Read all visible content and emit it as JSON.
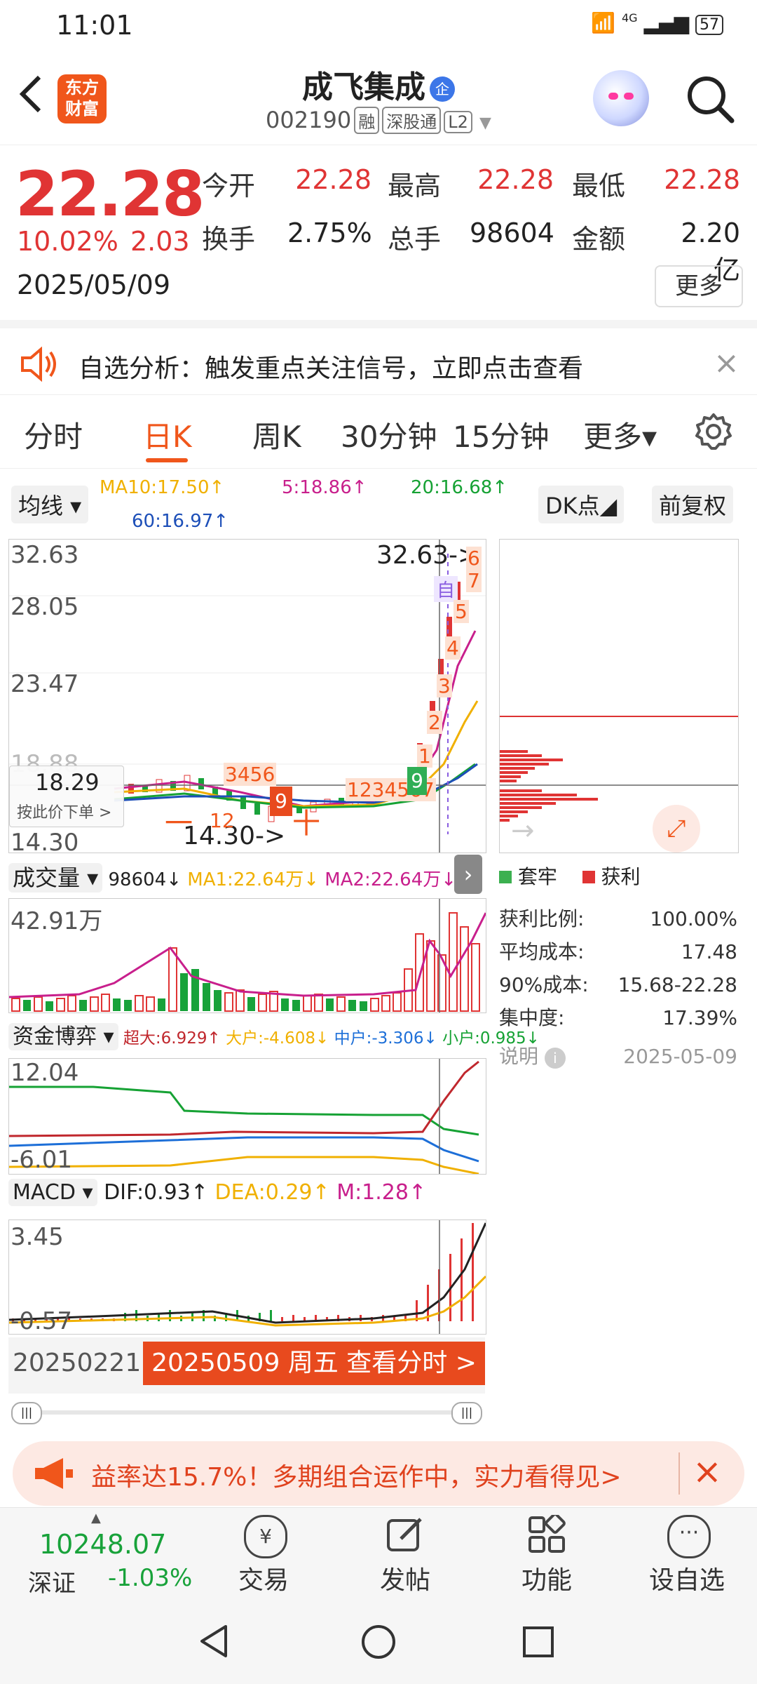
{
  "status_bar": {
    "time": "11:01",
    "battery": "57",
    "network": "4G"
  },
  "header": {
    "logo_line1": "东方",
    "logo_line2": "财富",
    "name": "成飞集成",
    "name_badge": "企",
    "code": "002190",
    "tags": [
      "融",
      "深股通",
      "L2"
    ]
  },
  "quote": {
    "price": "22.28",
    "change_pct": "10.02%",
    "change_val": "2.03",
    "date": "2025/05/09",
    "fields": [
      {
        "label": "今开",
        "value": "22.28",
        "color": "red"
      },
      {
        "label": "最高",
        "value": "22.28",
        "color": "red"
      },
      {
        "label": "最低",
        "value": "22.28",
        "color": "red"
      },
      {
        "label": "换手",
        "value": "2.75%",
        "color": "black"
      },
      {
        "label": "总手",
        "value": "98604",
        "color": "black"
      },
      {
        "label": "金额",
        "value": "2.20亿",
        "color": "black"
      }
    ],
    "more_label": "更多"
  },
  "analysis_banner": {
    "text": "自选分析：触发重点关注信号，立即点击查看",
    "close": "×"
  },
  "tabs": [
    {
      "label": "分时",
      "active": false
    },
    {
      "label": "日K",
      "active": true
    },
    {
      "label": "周K",
      "active": false
    },
    {
      "label": "30分钟",
      "active": false
    },
    {
      "label": "15分钟",
      "active": false
    },
    {
      "label": "更多▾",
      "active": false
    }
  ],
  "ma_row": {
    "selector": "均线 ▾",
    "ma10": "MA10:17.50↑",
    "ma5": "5:18.86↑",
    "ma20": "20:16.68↑",
    "ma60": "60:16.97↑",
    "dk_button": "DK点◢",
    "adjust_button": "前复权"
  },
  "kline": {
    "y_top": "32.63",
    "y_2": "28.05",
    "y_3": "23.47",
    "y_4": "18.88",
    "y_bottom": "14.30",
    "max_marker": "32.63->",
    "min_marker": "14.30->",
    "cursor_price": "18.29",
    "cursor_hint": "按此价下单 >",
    "seq_labels": [
      "1",
      "2",
      "3",
      "4",
      "5",
      "6",
      "7"
    ],
    "seq_top_mark": "6",
    "auto_label": "自",
    "early_seq": "3456",
    "mid_seq": "1234567",
    "nine_red": "9",
    "nine_green": "9",
    "early_seq2": "12",
    "cross_chars": [
      "一",
      "十"
    ]
  },
  "chip": {
    "legend_loss": "套牢",
    "legend_profit": "获利",
    "rows": [
      {
        "label": "获利比例:",
        "value": "100.00%"
      },
      {
        "label": "平均成本:",
        "value": "17.48"
      },
      {
        "label": "90%成本:",
        "value": "15.68-22.28"
      },
      {
        "label": "集中度:",
        "value": "17.39%"
      }
    ],
    "note_label": "说明",
    "note_date": "2025-05-09"
  },
  "volume": {
    "selector": "成交量 ▾",
    "value": "98604↓",
    "ma1": "MA1:22.64万↓",
    "ma2": "MA2:22.64万↓",
    "y_top": "42.91万"
  },
  "fund": {
    "selector": "资金博弈 ▾",
    "super": "超大:6.929↑",
    "large": "大户:-4.608↓",
    "mid": "中户:-3.306↓",
    "small": "小户:0.985↓",
    "y_top": "12.04",
    "y_bottom": "-6.01"
  },
  "macd": {
    "selector": "MACD ▾",
    "dif": "DIF:0.93↑",
    "dea": "DEA:0.29↑",
    "m": "M:1.28↑",
    "y_top": "3.45",
    "y_bottom": "-0.57"
  },
  "date_bar": {
    "start": "20250221",
    "current": "20250509 周五 查看分时 >"
  },
  "promo": {
    "text": "益率达15.7%！多期组合运作中，实力看得见>",
    "close": "×"
  },
  "bottom_nav": {
    "index_value": "10248.07",
    "index_name": "深证",
    "index_change": "-1.03%",
    "items": [
      "交易",
      "发帖",
      "功能",
      "设自选"
    ]
  },
  "colors": {
    "up": "#e03434",
    "down": "#18a23a",
    "accent": "#f0561b"
  }
}
